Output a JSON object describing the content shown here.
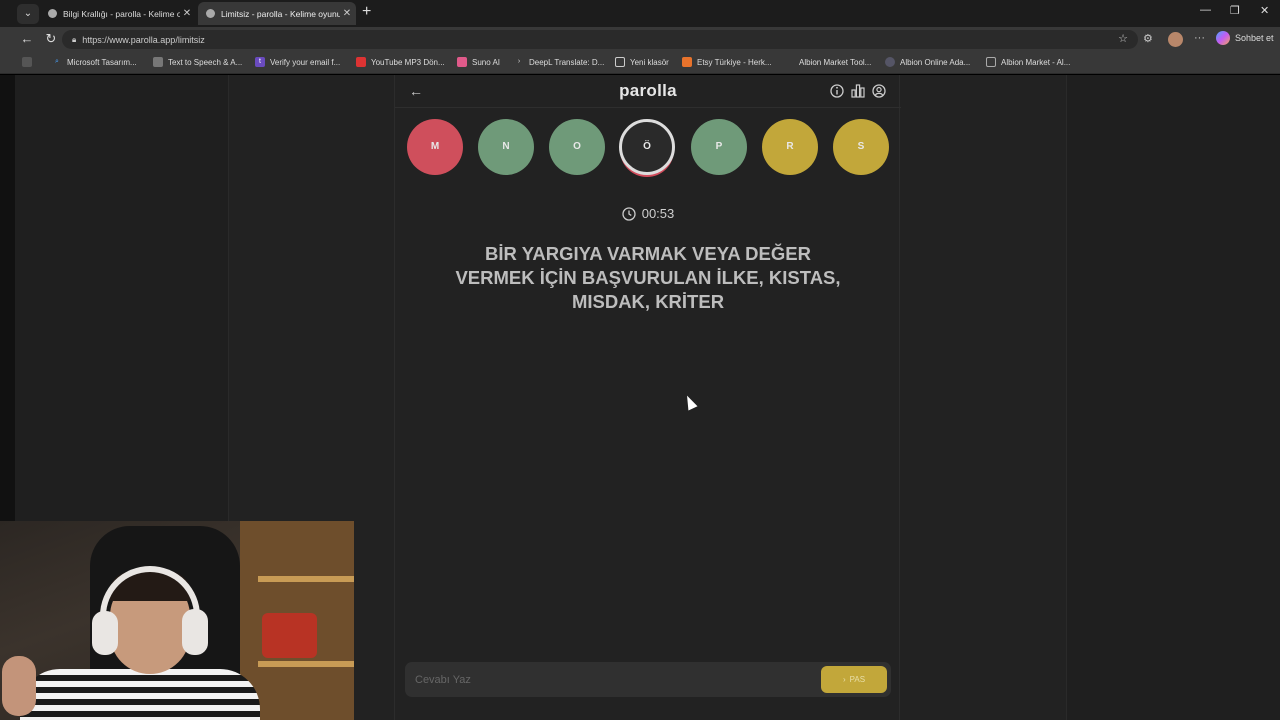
{
  "browser": {
    "tabs": [
      {
        "title": "Bilgi Krallığı - parolla - Kelime oyu",
        "active": false
      },
      {
        "title": "Limitsiz - parolla - Kelime oyunu",
        "active": true
      }
    ],
    "url": "https://www.parolla.app/limitsiz",
    "copilot_label": "Sohbet et",
    "bookmarks": [
      "Microsoft Tasarım...",
      "Text to Speech & A...",
      "Verify your email f...",
      "YouTube MP3 Dön...",
      "Suno AI",
      "DeepL Translate: D...",
      "Yeni klasör",
      "Etsy Türkiye - Herk...",
      "Albion Market Tool...",
      "Albion Online Ada...",
      "Albion Market - Al..."
    ]
  },
  "game": {
    "logo": "parolla",
    "letters": [
      {
        "letter": "M",
        "state": "wrong",
        "color": "#cf4f5c"
      },
      {
        "letter": "N",
        "state": "correct",
        "color": "#6f9a79"
      },
      {
        "letter": "O",
        "state": "correct",
        "color": "#6f9a79"
      },
      {
        "letter": "Ö",
        "state": "active",
        "color": "#2a2a2a"
      },
      {
        "letter": "P",
        "state": "correct",
        "color": "#6f9a79"
      },
      {
        "letter": "R",
        "state": "passed",
        "color": "#c2a73a"
      },
      {
        "letter": "S",
        "state": "passed",
        "color": "#c2a73a"
      }
    ],
    "timer": "00:53",
    "question": "BİR YARGIYA VARMAK VEYA DEĞER VERMEK İÇİN BAŞVURULAN İLKE, KISTAS, MISDAK, KRİTER",
    "answer_placeholder": "Cevabı Yaz",
    "pass_label": "PAS"
  }
}
